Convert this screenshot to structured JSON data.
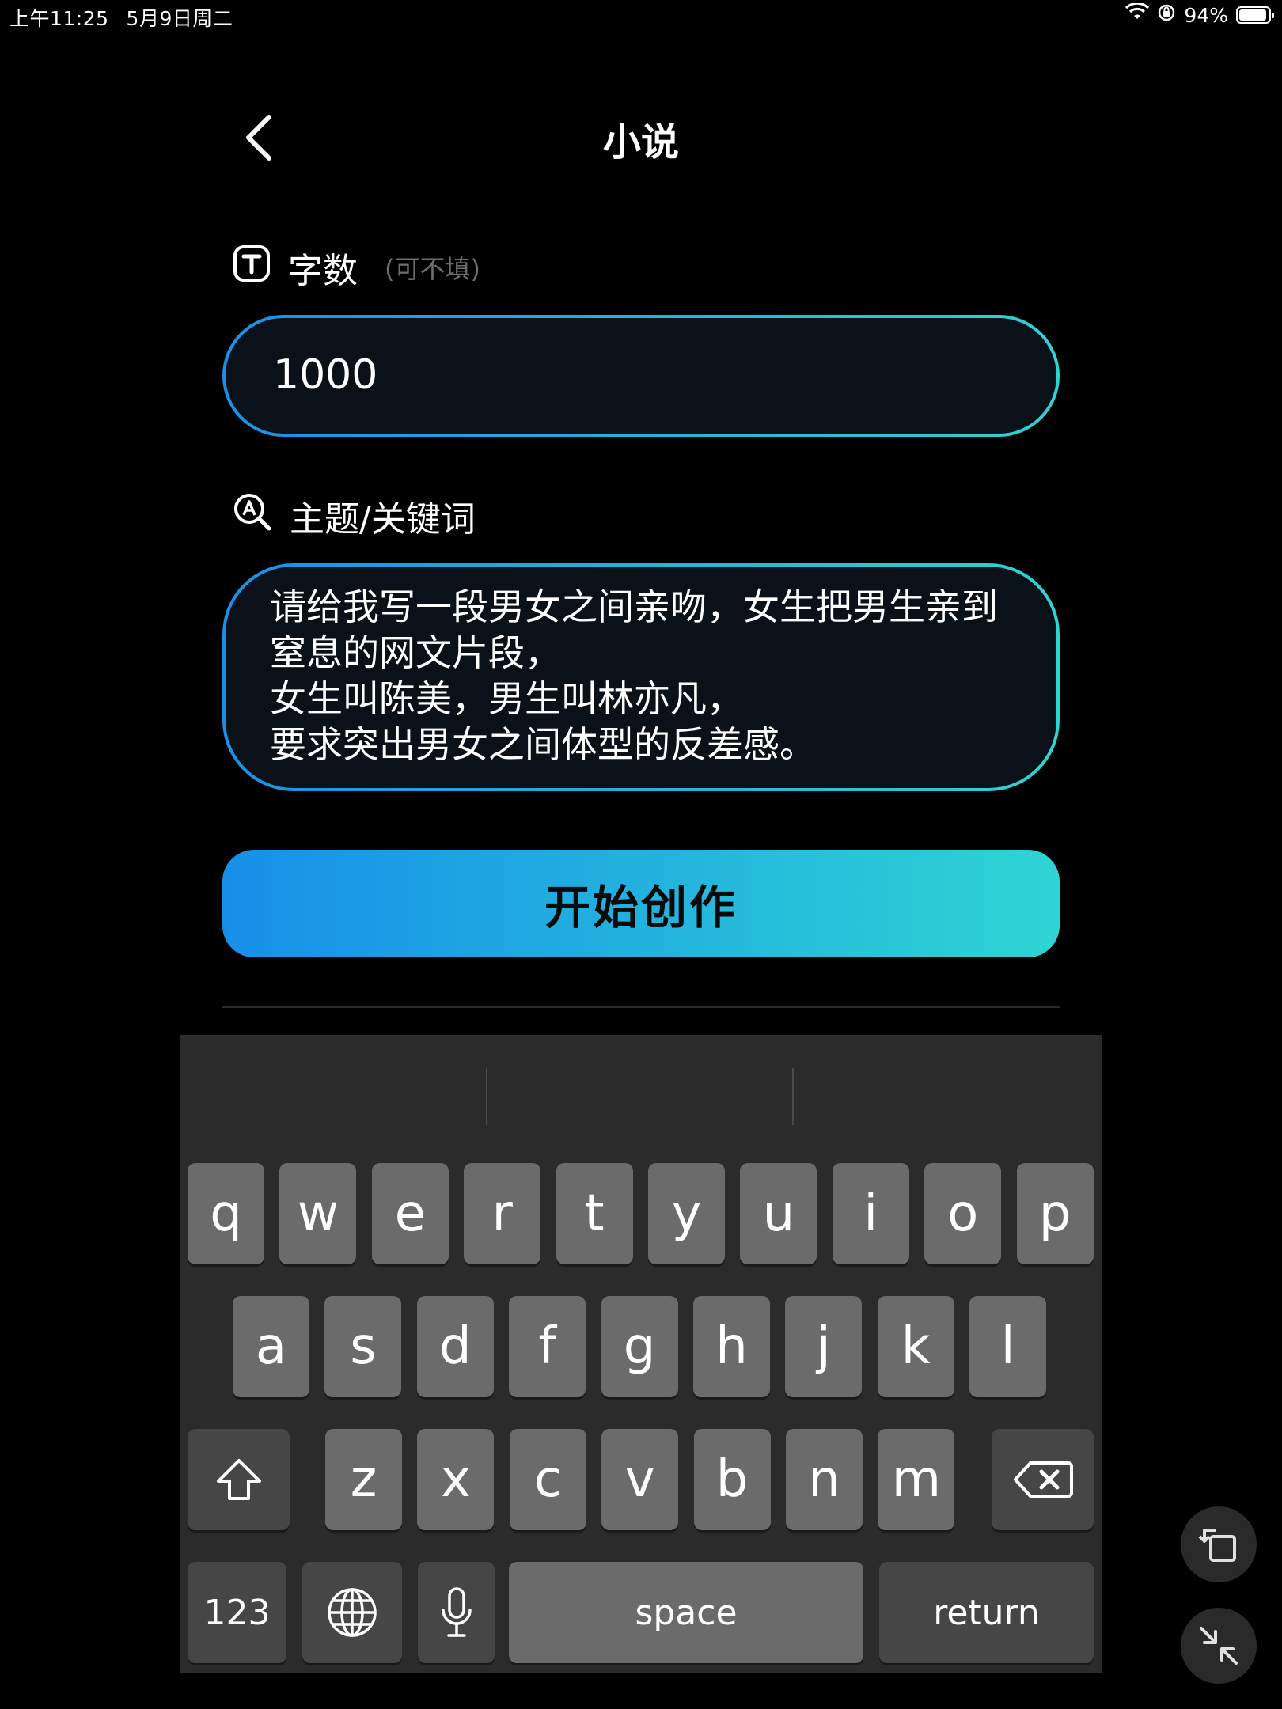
{
  "status_bar": {
    "time": "上午11:25",
    "date": "5月9日周二",
    "battery": "94%",
    "battery_level": 0.94
  },
  "header": {
    "title": "小说"
  },
  "word_count": {
    "label": "字数",
    "hint": "(可不填)",
    "value": "1000"
  },
  "keywords": {
    "label": "主题/关键词",
    "value": "请给我写一段男女之间亲吻，女生把男生亲到窒息的网文片段，\n女生叫陈美，男生叫林亦凡，\n要求突出男女之间体型的反差感。"
  },
  "start_button": {
    "label": "开始创作"
  },
  "keyboard": {
    "row1": [
      "q",
      "w",
      "e",
      "r",
      "t",
      "y",
      "u",
      "i",
      "o",
      "p"
    ],
    "row2": [
      "a",
      "s",
      "d",
      "f",
      "g",
      "h",
      "j",
      "k",
      "l"
    ],
    "row3": [
      "z",
      "x",
      "c",
      "v",
      "b",
      "n",
      "m"
    ],
    "numbers_label": "123",
    "space_label": "space",
    "return_label": "return"
  }
}
